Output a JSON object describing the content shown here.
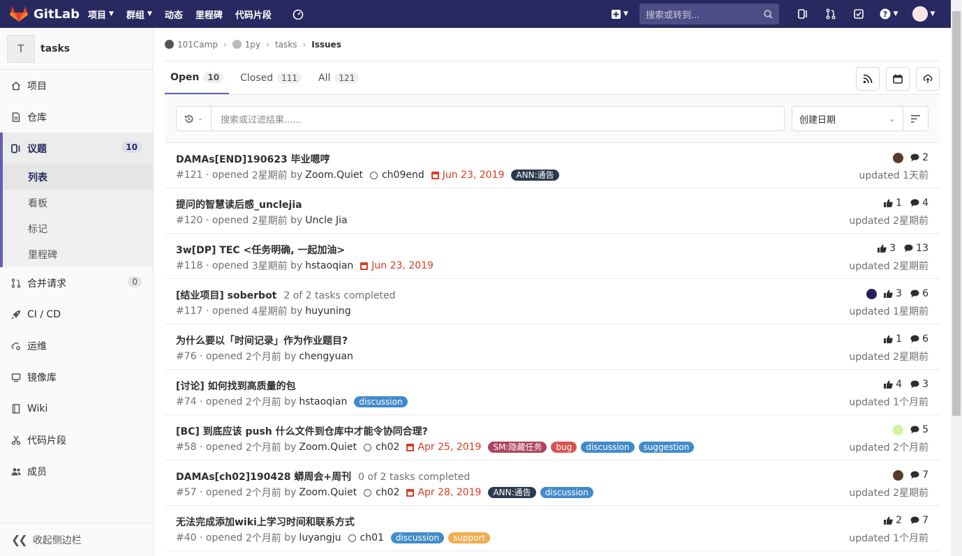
{
  "topnav": {
    "brand": "GitLab",
    "links": [
      {
        "label": "项目",
        "caret": true
      },
      {
        "label": "群组",
        "caret": true
      },
      {
        "label": "动态",
        "caret": false
      },
      {
        "label": "里程碑",
        "caret": false
      },
      {
        "label": "代码片段",
        "caret": false
      }
    ],
    "search_placeholder": "搜索或转到..."
  },
  "sidebar": {
    "project_letter": "T",
    "project_name": "tasks",
    "items": [
      {
        "label": "项目",
        "icon": "home-icon"
      },
      {
        "label": "仓库",
        "icon": "doc-icon"
      },
      {
        "label": "议题",
        "icon": "issues-icon",
        "count": "10",
        "active": true
      },
      {
        "label": "合并请求",
        "icon": "merge-icon",
        "count": "0"
      },
      {
        "label": "CI / CD",
        "icon": "rocket-icon"
      },
      {
        "label": "运维",
        "icon": "cloud-gear-icon"
      },
      {
        "label": "镜像库",
        "icon": "monitor-icon"
      },
      {
        "label": "Wiki",
        "icon": "book-icon"
      },
      {
        "label": "代码片段",
        "icon": "scissors-icon"
      },
      {
        "label": "成员",
        "icon": "users-icon"
      }
    ],
    "subitems": [
      "列表",
      "看板",
      "标记",
      "里程碑"
    ],
    "collapse_label": "收起侧边栏"
  },
  "breadcrumb": [
    "101Camp",
    "1py",
    "tasks",
    "Issues"
  ],
  "tabs": [
    {
      "label": "Open",
      "count": "10"
    },
    {
      "label": "Closed",
      "count": "111"
    },
    {
      "label": "All",
      "count": "121"
    }
  ],
  "filter": {
    "placeholder": "搜索或过滤结果......",
    "sort_label": "创建日期"
  },
  "colors": {
    "nav": "#292961",
    "accent": "#6060b3",
    "due": "#db3b21"
  },
  "issues": [
    {
      "title": "DAMAs[END]190623 毕业嗯哼",
      "tasks": "",
      "ref": "#121",
      "opened": "2星期前",
      "author": "Zoom.Quiet",
      "milestone": "ch09end",
      "due": "Jun 23, 2019",
      "labels": [
        {
          "text": "ANN:通告",
          "color": "#2c3a4d"
        }
      ],
      "avatar": "#5a3a2a",
      "upvotes": "",
      "comments": "2",
      "updated": "1天前"
    },
    {
      "title": "提问的智慧读后感_unclejia",
      "tasks": "",
      "ref": "#120",
      "opened": "2星期前",
      "author": "Uncle Jia",
      "milestone": "",
      "due": "",
      "labels": [],
      "avatar": "",
      "upvotes": "1",
      "comments": "4",
      "updated": "2星期前"
    },
    {
      "title": "3w[DP] TEC <任务明确, 一起加油>",
      "tasks": "",
      "ref": "#118",
      "opened": "3星期前",
      "author": "hstaoqian",
      "milestone": "",
      "due": "Jun 23, 2019",
      "labels": [],
      "avatar": "",
      "upvotes": "3",
      "comments": "13",
      "updated": "2星期前"
    },
    {
      "title": "[结业项目] soberbot",
      "tasks": "2 of 2 tasks completed",
      "ref": "#117",
      "opened": "4星期前",
      "author": "huyuning",
      "milestone": "",
      "due": "",
      "labels": [],
      "avatar": "#2a1f5c",
      "upvotes": "3",
      "comments": "6",
      "updated": "1星期前"
    },
    {
      "title": "为什么要以「时间记录」作为作业题目?",
      "tasks": "",
      "ref": "#76",
      "opened": "2个月前",
      "author": "chengyuan",
      "milestone": "",
      "due": "",
      "labels": [],
      "avatar": "",
      "upvotes": "1",
      "comments": "6",
      "updated": "2星期前"
    },
    {
      "title": "[讨论] 如何找到高质量的包",
      "tasks": "",
      "ref": "#74",
      "opened": "2个月前",
      "author": "hstaoqian",
      "milestone": "",
      "due": "",
      "labels": [
        {
          "text": "discussion",
          "color": "#428bca"
        }
      ],
      "avatar": "",
      "upvotes": "4",
      "comments": "3",
      "updated": "1个月前"
    },
    {
      "title": "[BC] 到底应该 push 什么文件到仓库中才能令协同合理?",
      "tasks": "",
      "ref": "#58",
      "opened": "2个月前",
      "author": "Zoom.Quiet",
      "milestone": "ch02",
      "due": "Apr 25, 2019",
      "labels": [
        {
          "text": "SM:隐藏任务",
          "color": "#ad4363"
        },
        {
          "text": "bug",
          "color": "#d9534f"
        },
        {
          "text": "discussion",
          "color": "#428bca"
        },
        {
          "text": "suggestion",
          "color": "#428bca"
        }
      ],
      "avatar": "#d4f0a0",
      "upvotes": "",
      "comments": "5",
      "updated": "2个月前"
    },
    {
      "title": "DAMAs[ch02]190428 蟒周会+周刊",
      "tasks": "0 of 2 tasks completed",
      "ref": "#57",
      "opened": "2个月前",
      "author": "Zoom.Quiet",
      "milestone": "ch02",
      "due": "Apr 28, 2019",
      "labels": [
        {
          "text": "ANN:通告",
          "color": "#2c3a4d"
        },
        {
          "text": "discussion",
          "color": "#428bca"
        }
      ],
      "avatar": "#5a3a2a",
      "upvotes": "",
      "comments": "7",
      "updated": "2星期前"
    },
    {
      "title": "无法完成添加wiki上学习时间和联系方式",
      "tasks": "",
      "ref": "#40",
      "opened": "2个月前",
      "author": "luyangju",
      "milestone": "ch01",
      "due": "",
      "labels": [
        {
          "text": "discussion",
          "color": "#428bca"
        },
        {
          "text": "support",
          "color": "#f0ad4e"
        }
      ],
      "avatar": "",
      "upvotes": "2",
      "comments": "7",
      "updated": "1个月前"
    }
  ],
  "strings": {
    "opened": "opened",
    "by": "by",
    "updated": "updated"
  }
}
